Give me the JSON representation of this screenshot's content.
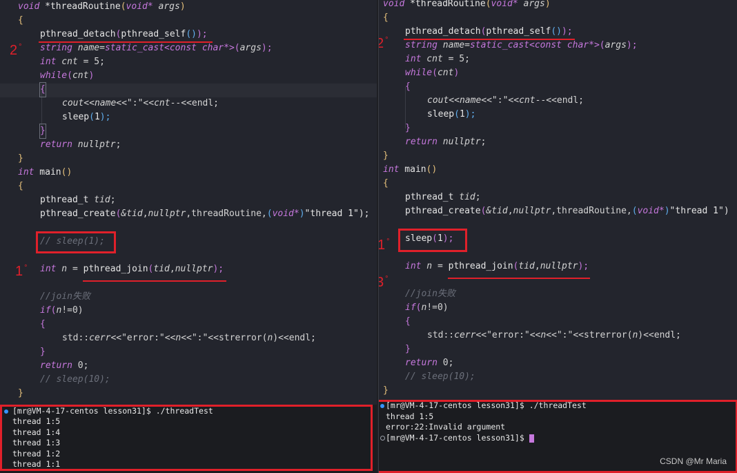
{
  "left": {
    "code": {
      "l1": {
        "kw": "void",
        "fn": "*threadRoutine",
        "p1": "(",
        "ty": "void*",
        "v": " args",
        "p2": ")"
      },
      "l2": "{",
      "l3": {
        "fn": "pthread_detach",
        "p1": "(",
        "fn2": "pthread_self",
        "p2": "()",
        "p3": ");"
      },
      "l4": {
        "ty": "string",
        "v": " name",
        "eq": "=",
        "fn": "static_cast",
        "t": "<const char*>",
        "p": "(",
        "a": "args",
        "e": ");"
      },
      "l5": {
        "ty": "int",
        "v": " cnt",
        "e": " = 5;"
      },
      "l6": {
        "kw": "while",
        "p": "(",
        "v": "cnt",
        "e": ")"
      },
      "l7": "{",
      "l8": {
        "a": "cout<<",
        "v": "name",
        "b": "<<\":\"<<",
        "c": "cnt",
        "d": "--<<endl;"
      },
      "l9": {
        "fn": "sleep",
        "p": "(",
        "n": "1",
        "e": ");"
      },
      "l10": "}",
      "l11": {
        "kw": "return",
        "v": " nullptr",
        "e": ";"
      },
      "l12": "}",
      "l13": {
        "ty": "int",
        "fn": " main",
        "e": "()"
      },
      "l14": "{",
      "l15": {
        "a": "pthread_t",
        "v": " tid",
        "e": ";"
      },
      "l16": {
        "fn": "pthread_create",
        "p": "(",
        "a": "&tid",
        "b": ",",
        "c": "nullptr",
        "d": ",threadRoutine,",
        "e": "(",
        "f": "void*",
        "g": ")",
        "h": "\"thread 1\");"
      },
      "l18": "// sleep(1);",
      "l20": {
        "ty": "int",
        "v": " n",
        "eq": " = ",
        "fn": "pthread_join",
        "p": "(",
        "a": "tid",
        "b": ",",
        "c": "nullptr",
        "e": ");"
      },
      "l22": "//join失败",
      "l23": {
        "kw": "if",
        "p": "(",
        "v": "n",
        "e": "!=0)"
      },
      "l24": "{",
      "l25": {
        "a": "std::",
        "b": "cerr",
        "c": "<<\"error:\"<<",
        "d": "n",
        "e": "<<\":\"<<strerror(",
        "f": "n",
        "g": ")<<endl;"
      },
      "l26": "}",
      "l27": {
        "kw": "return",
        "e": " 0;"
      },
      "l28": "// sleep(10);",
      "l29": "}"
    },
    "markers": {
      "m2": "2",
      "m1": "1"
    },
    "terminal": {
      "prompt": "[mr@VM-4-17-centos lesson31]$ ./threadTest",
      "out": [
        "thread 1:5",
        "thread 1:4",
        "thread 1:3",
        "thread 1:2",
        "thread 1:1"
      ]
    }
  },
  "right": {
    "code": {
      "l1": {
        "kw": "void",
        "fn": "*threadRoutine",
        "p1": "(",
        "ty": "void*",
        "v": " args",
        "p2": ")"
      },
      "l2": "{",
      "l3": {
        "fn": "pthread_detach",
        "p1": "(",
        "fn2": "pthread_self",
        "p2": "()",
        "p3": ");"
      },
      "l4": {
        "ty": "string",
        "v": " name",
        "eq": "=",
        "fn": "static_cast",
        "t": "<const char*>",
        "p": "(",
        "a": "args",
        "e": ");"
      },
      "l5": {
        "ty": "int",
        "v": " cnt",
        "e": " = 5;"
      },
      "l6": {
        "kw": "while",
        "p": "(",
        "v": "cnt",
        "e": ")"
      },
      "l7": "{",
      "l8": {
        "a": "cout<<",
        "v": "name",
        "b": "<<\":\"<<",
        "c": "cnt",
        "d": "--<<endl;"
      },
      "l9": {
        "fn": "sleep",
        "p": "(",
        "n": "1",
        "e": ");"
      },
      "l10": "}",
      "l11": {
        "kw": "return",
        "v": " nullptr",
        "e": ";"
      },
      "l12": "}",
      "l13": {
        "ty": "int",
        "fn": " main",
        "e": "()"
      },
      "l14": "{",
      "l15": {
        "a": "pthread_t",
        "v": " tid",
        "e": ";"
      },
      "l16": {
        "fn": "pthread_create",
        "p": "(",
        "a": "&tid",
        "b": ",",
        "c": "nullptr",
        "d": ",threadRoutine,",
        "e": "(",
        "f": "void*",
        "g": ")",
        "h": "\"thread 1\")"
      },
      "l18": {
        "fn": "sleep",
        "p": "(",
        "n": "1",
        "e": ");"
      },
      "l20": {
        "ty": "int",
        "v": " n",
        "eq": " = ",
        "fn": "pthread_join",
        "p": "(",
        "a": "tid",
        "b": ",",
        "c": "nullptr",
        "e": ");"
      },
      "l22": "//join失败",
      "l23": {
        "kw": "if",
        "p": "(",
        "v": "n",
        "e": "!=0)"
      },
      "l24": "{",
      "l25": {
        "a": "std::",
        "b": "cerr",
        "c": "<<\"error:\"<<",
        "d": "n",
        "e": "<<\":\"<<strerror(",
        "f": "n",
        "g": ")<<endl;"
      },
      "l26": "}",
      "l27": {
        "kw": "return",
        "e": " 0;"
      },
      "l28": "// sleep(10);",
      "l29": "}"
    },
    "markers": {
      "m2": "2",
      "m1": "1",
      "m3": "3"
    },
    "terminal": {
      "prompt": "[mr@VM-4-17-centos lesson31]$ ./threadTest",
      "out": [
        "thread 1:5",
        "error:22:Invalid argument"
      ],
      "prompt2": "[mr@VM-4-17-centos lesson31]$ "
    }
  },
  "watermark": "CSDN @Mr Maria",
  "colors": {
    "annotation": "#e0202a",
    "keyword": "#c678dd",
    "bracket_outer": "#e5c07b",
    "bracket_inner": "#61afef"
  }
}
